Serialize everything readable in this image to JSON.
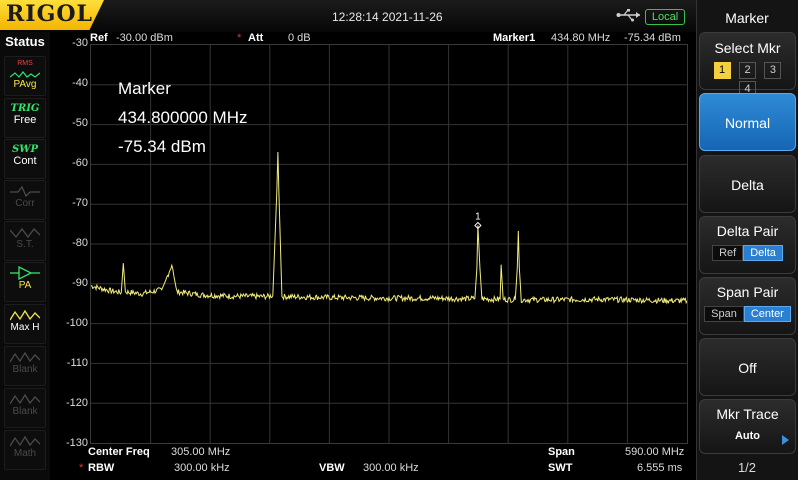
{
  "brand": "RIGOL",
  "datetime": "12:28:14 2021-11-26",
  "remote_status": "Local",
  "status_panel": {
    "title": "Status",
    "items": [
      {
        "line1": "RMS",
        "line2": "PAvg",
        "state": "on"
      },
      {
        "line1": "TRIG",
        "line2": "Free",
        "state": "on"
      },
      {
        "line1": "SWP",
        "line2": "Cont",
        "state": "on"
      },
      {
        "line1": "",
        "line2": "Corr",
        "state": "dim"
      },
      {
        "line1": "",
        "line2": "S.T.",
        "state": "dim"
      },
      {
        "line1": "",
        "line2": "PA",
        "state": "on"
      },
      {
        "line1": "",
        "line2": "Max H",
        "state": "on"
      },
      {
        "line1": "",
        "line2": "Blank",
        "state": "dim"
      },
      {
        "line1": "",
        "line2": "Blank",
        "state": "dim"
      },
      {
        "line1": "",
        "line2": "Math",
        "state": "dim"
      }
    ]
  },
  "header": {
    "ref_label": "Ref",
    "ref_value": "-30.00 dBm",
    "att_label": "Att",
    "att_value": "0 dB",
    "marker_label": "Marker1",
    "marker_freq": "434.80 MHz",
    "marker_level": "-75.34 dBm"
  },
  "marker_readout": {
    "title": "Marker",
    "frequency": "434.800000 MHz",
    "level": "-75.34 dBm"
  },
  "y_axis_labels": [
    "-30",
    "-40",
    "-50",
    "-60",
    "-70",
    "-80",
    "-90",
    "-100",
    "-110",
    "-120",
    "-130"
  ],
  "chart_data": {
    "type": "line",
    "x_start_mhz": 10.0,
    "x_stop_mhz": 600.0,
    "ylim": [
      -130,
      -30
    ],
    "grid": true,
    "series": [
      {
        "color": "#f2ec7a",
        "points": [
          [
            10,
            -90.5
          ],
          [
            30,
            -91.8
          ],
          [
            40,
            -92.2
          ],
          [
            42,
            -84.8
          ],
          [
            44,
            -92
          ],
          [
            60,
            -92.5
          ],
          [
            80,
            -91.5
          ],
          [
            85,
            -88.5
          ],
          [
            88,
            -86.5
          ],
          [
            90,
            -85.2
          ],
          [
            92,
            -88
          ],
          [
            95,
            -92
          ],
          [
            120,
            -92.8
          ],
          [
            150,
            -93.1
          ],
          [
            185,
            -93.2
          ],
          [
            190,
            -92.9
          ],
          [
            194,
            -66.5
          ],
          [
            195,
            -56.9
          ],
          [
            196,
            -67
          ],
          [
            199,
            -93.2
          ],
          [
            240,
            -93.4
          ],
          [
            300,
            -93.6
          ],
          [
            350,
            -93.6
          ],
          [
            380,
            -93.8
          ],
          [
            390,
            -93.7
          ],
          [
            392,
            -86
          ],
          [
            393,
            -75.3
          ],
          [
            395,
            -86
          ],
          [
            397,
            -93.8
          ],
          [
            410,
            -93.9
          ],
          [
            415,
            -93.8
          ],
          [
            416,
            -85.2
          ],
          [
            418,
            -93.9
          ],
          [
            430,
            -94
          ],
          [
            432,
            -86
          ],
          [
            433,
            -76.7
          ],
          [
            434,
            -86
          ],
          [
            436,
            -94
          ],
          [
            470,
            -94
          ],
          [
            510,
            -93.9
          ],
          [
            560,
            -94.1
          ],
          [
            600,
            -94.3
          ]
        ]
      }
    ],
    "marker": {
      "label": "1",
      "x": 393,
      "y": -75.34
    }
  },
  "footer": {
    "center_label": "Center Freq",
    "center_value": "305.00 MHz",
    "span_label": "Span",
    "span_value": "590.00 MHz",
    "rbw_label": "RBW",
    "rbw_value": "300.00 kHz",
    "vbw_label": "VBW",
    "vbw_value": "300.00 kHz",
    "swt_label": "SWT",
    "swt_value": "6.555 ms"
  },
  "right_panel": {
    "title": "Marker",
    "select_mkr_label": "Select Mkr",
    "markers": [
      "1",
      "2",
      "3",
      "4"
    ],
    "normal_label": "Normal",
    "delta_label": "Delta",
    "delta_pair_label": "Delta Pair",
    "delta_pair_options": [
      "Ref",
      "Delta"
    ],
    "span_pair_label": "Span Pair",
    "span_pair_options": [
      "Span",
      "Center"
    ],
    "off_label": "Off",
    "mkr_trace_label": "Mkr Trace",
    "mkr_trace_value": "Auto",
    "page": "1/2"
  }
}
